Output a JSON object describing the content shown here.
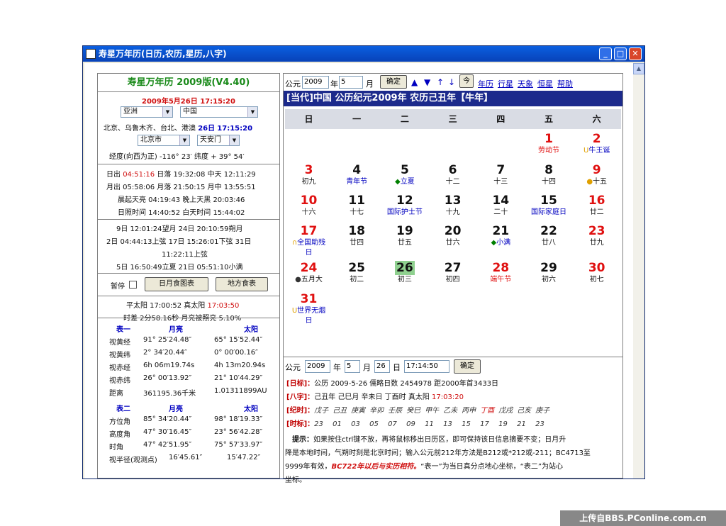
{
  "window": {
    "title": "寿星万年历(日历,农历,星历,八字)"
  },
  "left": {
    "app_title": "寿星万年历  2009版(V4.40)",
    "datetime_date": "2009年5月26日",
    "datetime_time": "17:15:20",
    "region": "亚洲",
    "country": "中国",
    "zone_text": "北京、乌鲁木齐、台北、港澳",
    "zone_day": "26日",
    "zone_time": "17:15:20",
    "city": "北京市",
    "spot": "天安门",
    "coord": "经度(向西为正) -116° 23′ 纬度 + 39° 54′",
    "sun": {
      "rise_label": "日出",
      "rise": "04:51:16",
      "set": "日落 19:32:08",
      "noon": "中天 12:11:29",
      "moon_line": "月出 05:58:06 月落 21:50:15 月中 13:55:51",
      "dawn_line": "晨起天亮 04:19:43 晚上天黑 20:03:46",
      "dur_line": "日照时间 14:40:52 白天时间 15:44:02"
    },
    "moon_phase": {
      "l1": "9日 12:01:24望月  24日 20:10:59朔月",
      "l2": "2日 04:44:13上弦  17日 15:26:01下弦  31日",
      "l3": "11:22:11上弦",
      "l4": "5日 16:50:49立夏  21日 05:51:10小满"
    },
    "pause_label": "暂停",
    "btn_eclipse": "日月食图表",
    "btn_local": "地方食表",
    "mean_sun": "平太阳 17:00:52 真太阳",
    "true_sun": "17:03:50",
    "eq_line": "时差 2分58.16秒 月亮被照亮 5.10%",
    "table1": {
      "h": [
        "表一",
        "月亮",
        "太阳"
      ],
      "rows": [
        [
          "视黄经",
          "91° 25′24.48″",
          "65° 15′52.44″"
        ],
        [
          "视黄纬",
          "2° 34′20.44″",
          "0° 00′00.16″"
        ],
        [
          "视赤经",
          "6h 06m19.74s",
          "4h 13m20.94s"
        ],
        [
          "视赤纬",
          "26° 00′13.92″",
          "21° 10′44.29″"
        ],
        [
          "距离",
          "361195.36千米",
          "1.01311899AU"
        ]
      ]
    },
    "table2": {
      "h": [
        "表二",
        "月亮",
        "太阳"
      ],
      "rows": [
        [
          "方位角",
          "85° 34′20.44″",
          "98° 18′19.33″"
        ],
        [
          "高度角",
          "47° 30′16.45″",
          "23° 56′42.28″"
        ],
        [
          "时角",
          "47° 42′51.95″",
          "75° 57′33.97″"
        ],
        [
          "视半径(观测点)",
          "16′45.61″",
          "15′47.22″"
        ]
      ]
    }
  },
  "right": {
    "top": {
      "gy": "公元",
      "year": "2009",
      "nian": "年",
      "month": "5",
      "yue": "月",
      "ok": "确定",
      "arrows": [
        "▲",
        "▼",
        "↑",
        "↓"
      ],
      "jin": "今",
      "links": [
        "年历",
        "行星",
        "天象",
        "恒星",
        "帮助"
      ]
    },
    "header": "[当代]中国  公历纪元2009年  农历己丑年【牛年】",
    "weekdays": [
      "日",
      "一",
      "二",
      "三",
      "四",
      "五",
      "六"
    ],
    "days": [
      {
        "n": "1",
        "s": "劳动节",
        "col": 5,
        "row": 0,
        "nc": "red",
        "sc": "red"
      },
      {
        "n": "2",
        "s": "牛王诞",
        "col": 6,
        "row": 0,
        "nc": "red",
        "sc": "blue",
        "m": "U"
      },
      {
        "n": "3",
        "s": "初九",
        "col": 0,
        "row": 1,
        "nc": "red"
      },
      {
        "n": "4",
        "s": "青年节",
        "col": 1,
        "row": 1,
        "sc": "blue"
      },
      {
        "n": "5",
        "s": "立夏",
        "col": 2,
        "row": 1,
        "sc": "blue",
        "m": "◆"
      },
      {
        "n": "6",
        "s": "十二",
        "col": 3,
        "row": 1
      },
      {
        "n": "7",
        "s": "十三",
        "col": 4,
        "row": 1
      },
      {
        "n": "8",
        "s": "十四",
        "col": 5,
        "row": 1
      },
      {
        "n": "9",
        "s": "十五",
        "col": 6,
        "row": 1,
        "nc": "red",
        "m": "●"
      },
      {
        "n": "10",
        "s": "十六",
        "col": 0,
        "row": 2,
        "nc": "red"
      },
      {
        "n": "11",
        "s": "十七",
        "col": 1,
        "row": 2
      },
      {
        "n": "12",
        "s": "国际护士节",
        "col": 2,
        "row": 2,
        "sc": "blue"
      },
      {
        "n": "13",
        "s": "十九",
        "col": 3,
        "row": 2
      },
      {
        "n": "14",
        "s": "二十",
        "col": 4,
        "row": 2
      },
      {
        "n": "15",
        "s": "国际家庭日",
        "col": 5,
        "row": 2,
        "sc": "blue"
      },
      {
        "n": "16",
        "s": "廿二",
        "col": 6,
        "row": 2,
        "nc": "red"
      },
      {
        "n": "17",
        "s": "全国助残",
        "s2": "日",
        "col": 0,
        "row": 3,
        "nc": "red",
        "sc": "blue",
        "m": "∩"
      },
      {
        "n": "18",
        "s": "廿四",
        "col": 1,
        "row": 3
      },
      {
        "n": "19",
        "s": "廿五",
        "col": 2,
        "row": 3
      },
      {
        "n": "20",
        "s": "廿六",
        "col": 3,
        "row": 3
      },
      {
        "n": "21",
        "s": "小满",
        "col": 4,
        "row": 3,
        "sc": "blue",
        "m": "◆"
      },
      {
        "n": "22",
        "s": "廿八",
        "col": 5,
        "row": 3
      },
      {
        "n": "23",
        "s": "廿九",
        "col": 6,
        "row": 3,
        "nc": "red"
      },
      {
        "n": "24",
        "s": "五月大",
        "col": 0,
        "row": 4,
        "nc": "red",
        "m": "●"
      },
      {
        "n": "25",
        "s": "初二",
        "col": 1,
        "row": 4
      },
      {
        "n": "26",
        "s": "初三",
        "col": 2,
        "row": 4,
        "today": true
      },
      {
        "n": "27",
        "s": "初四",
        "col": 3,
        "row": 4
      },
      {
        "n": "28",
        "s": "端午节",
        "col": 4,
        "row": 4,
        "nc": "red",
        "sc": "red"
      },
      {
        "n": "29",
        "s": "初六",
        "col": 5,
        "row": 4
      },
      {
        "n": "30",
        "s": "初七",
        "col": 6,
        "row": 4,
        "nc": "red"
      },
      {
        "n": "31",
        "s": "世界无烟",
        "s2": "日",
        "col": 0,
        "row": 5,
        "nc": "red",
        "sc": "blue",
        "m": "U"
      }
    ],
    "bottom": {
      "gy": "公元",
      "year": "2009",
      "nian": "年",
      "month": "5",
      "yue": "月",
      "day": "26",
      "ri": "日",
      "time": "17:14:50",
      "ok": "确定"
    },
    "info": {
      "ribiao_l": "[日标]：",
      "ribiao": "公历 2009-5-26 儒略日数 2454978 距2000年首3433日",
      "bazi_l": "[八字]：",
      "bazi": "己丑年 己巳月 辛未日 丁酉时 真太阳",
      "bazi_t": "17:03:20",
      "jishi_l": "[纪时]：",
      "jishi": [
        "戊子",
        "己丑",
        "庚寅",
        "辛卯",
        "壬辰",
        "癸巳",
        "甲午",
        "乙未",
        "丙申",
        "丁酉",
        "戊戌",
        "己亥",
        "庚子"
      ],
      "shibiao_l": "[时标]：",
      "shibiao": [
        "23",
        "01",
        "03",
        "05",
        "07",
        "09",
        "11",
        "13",
        "15",
        "17",
        "19",
        "21",
        "23"
      ],
      "tip_l": "提示：",
      "tip1": "如果按住ctrl键不放，再将鼠标移出日历区，即可保持该日信息摘要不变；日月升",
      "tip2": "降是本地时间，气朔时刻是北京时间；输入公元前212年方法是B212或*212或-211；BC4713至",
      "tip3a": "9999年有效，",
      "tip3b": "BC722年以后与实历相符。",
      "tip3c": "“表一”为当日真分点地心坐标，“表二”为站心",
      "tip4": "坐标。"
    }
  },
  "watermark": "上传自BBS.PConline.com.cn"
}
